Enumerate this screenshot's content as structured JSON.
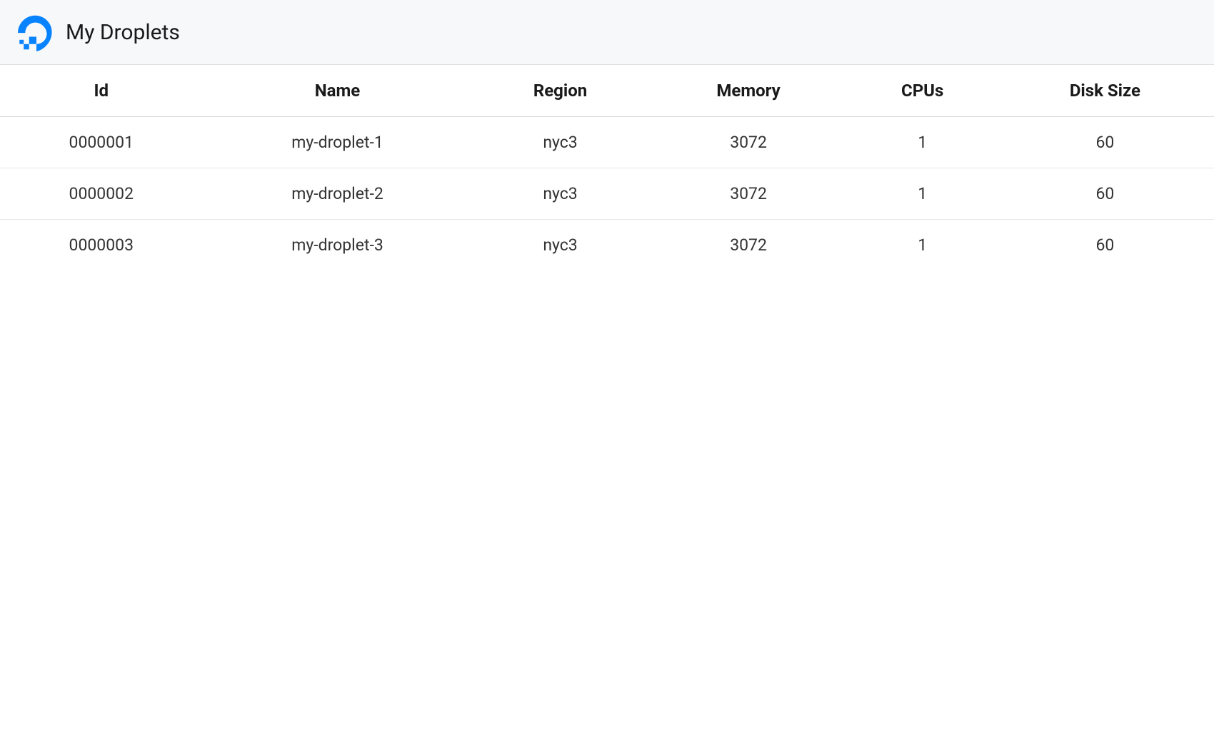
{
  "header": {
    "title": "My Droplets"
  },
  "table": {
    "columns": [
      "Id",
      "Name",
      "Region",
      "Memory",
      "CPUs",
      "Disk Size"
    ],
    "rows": [
      {
        "id": "0000001",
        "name": "my-droplet-1",
        "region": "nyc3",
        "memory": "3072",
        "cpus": "1",
        "disk": "60"
      },
      {
        "id": "0000002",
        "name": "my-droplet-2",
        "region": "nyc3",
        "memory": "3072",
        "cpus": "1",
        "disk": "60"
      },
      {
        "id": "0000003",
        "name": "my-droplet-3",
        "region": "nyc3",
        "memory": "3072",
        "cpus": "1",
        "disk": "60"
      }
    ]
  }
}
